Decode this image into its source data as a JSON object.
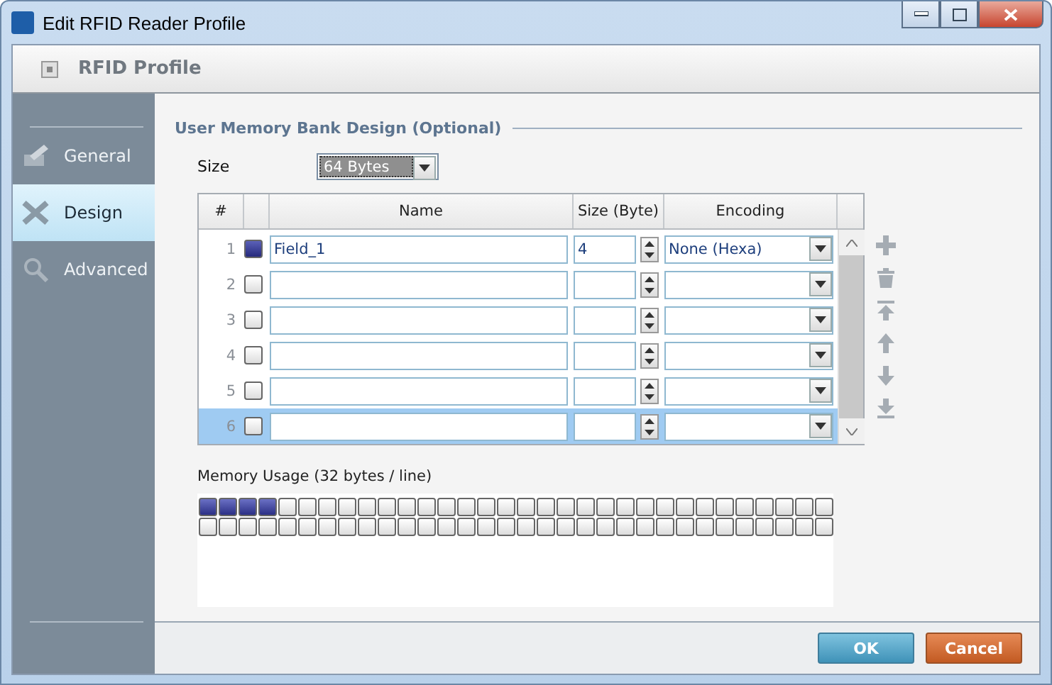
{
  "window": {
    "title": "Edit RFID Reader Profile"
  },
  "header": {
    "title": "RFID Profile"
  },
  "sidebar": {
    "items": [
      {
        "label": "General",
        "selected": false,
        "kind": "general"
      },
      {
        "label": "Design",
        "selected": true,
        "kind": "design"
      },
      {
        "label": "Advanced",
        "selected": false,
        "kind": "advanced"
      }
    ]
  },
  "section": {
    "title": "User Memory Bank Design (Optional)"
  },
  "size": {
    "label": "Size",
    "value": "64 Bytes"
  },
  "table": {
    "columns": [
      "#",
      "Name",
      "Size (Byte)",
      "Encoding"
    ],
    "rows": [
      {
        "index": "1",
        "checked": true,
        "selected": false,
        "name": "Field_1",
        "size": "4",
        "encoding": "None (Hexa)"
      },
      {
        "index": "2",
        "checked": false,
        "selected": false
      },
      {
        "index": "3",
        "checked": false,
        "selected": false
      },
      {
        "index": "4",
        "checked": false,
        "selected": false
      },
      {
        "index": "5",
        "checked": false,
        "selected": false
      },
      {
        "index": "6",
        "checked": false,
        "selected": true
      }
    ]
  },
  "memory": {
    "label": "Memory Usage (32 bytes / line)",
    "level": 0.0625
  },
  "buttons": [
    {
      "label": "OK",
      "kind": "primary"
    },
    {
      "label": "Cancel",
      "kind": "cancel"
    }
  ]
}
